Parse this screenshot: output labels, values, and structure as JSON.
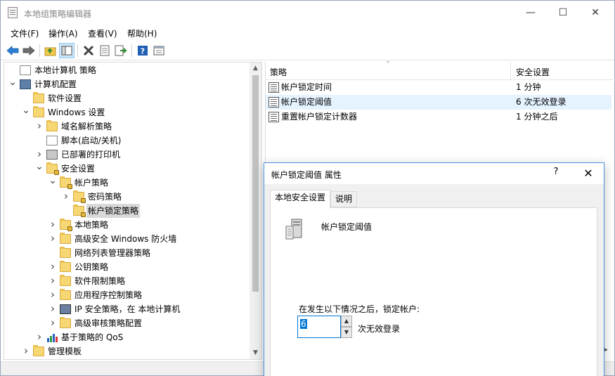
{
  "window": {
    "title": "本地组策略编辑器",
    "minimize": "—",
    "maximize": "☐",
    "close": "✕"
  },
  "menu": [
    "文件(F)",
    "操作(A)",
    "查看(V)",
    "帮助(H)"
  ],
  "toolbar": [
    "back-icon",
    "forward-icon",
    "up-icon",
    "show-tree-icon",
    "delete-icon",
    "properties-icon",
    "export-icon",
    "help-icon",
    "view-icon"
  ],
  "tree": [
    {
      "label": "本地计算机 策略",
      "icon": "policy-doc",
      "depth": 0,
      "chevron": ""
    },
    {
      "label": "计算机配置",
      "icon": "computer",
      "depth": 0,
      "chevron": "expanded"
    },
    {
      "label": "软件设置",
      "icon": "folder",
      "depth": 1,
      "chevron": ""
    },
    {
      "label": "Windows 设置",
      "icon": "folder",
      "depth": 1,
      "chevron": "expanded"
    },
    {
      "label": "域名解析策略",
      "icon": "folder",
      "depth": 2,
      "chevron": "collapsed"
    },
    {
      "label": "脚本(启动/关机)",
      "icon": "script",
      "depth": 2,
      "chevron": ""
    },
    {
      "label": "已部署的打印机",
      "icon": "printer",
      "depth": 2,
      "chevron": "collapsed"
    },
    {
      "label": "安全设置",
      "icon": "security",
      "depth": 2,
      "chevron": "expanded"
    },
    {
      "label": "帐户策略",
      "icon": "folder-lock",
      "depth": 3,
      "chevron": "expanded"
    },
    {
      "label": "密码策略",
      "icon": "folder-lock",
      "depth": 4,
      "chevron": "collapsed"
    },
    {
      "label": "帐户锁定策略",
      "icon": "folder-lock",
      "depth": 4,
      "chevron": "",
      "selected": true
    },
    {
      "label": "本地策略",
      "icon": "folder-lock",
      "depth": 3,
      "chevron": "collapsed"
    },
    {
      "label": "高级安全 Windows 防火墙",
      "icon": "folder",
      "depth": 3,
      "chevron": "collapsed"
    },
    {
      "label": "网络列表管理器策略",
      "icon": "folder",
      "depth": 3,
      "chevron": ""
    },
    {
      "label": "公钥策略",
      "icon": "folder",
      "depth": 3,
      "chevron": "collapsed"
    },
    {
      "label": "软件限制策略",
      "icon": "folder",
      "depth": 3,
      "chevron": "collapsed"
    },
    {
      "label": "应用程序控制策略",
      "icon": "folder",
      "depth": 3,
      "chevron": "collapsed"
    },
    {
      "label": "IP 安全策略，在 本地计算机",
      "icon": "netpc",
      "depth": 3,
      "chevron": "collapsed"
    },
    {
      "label": "高级审核策略配置",
      "icon": "folder",
      "depth": 3,
      "chevron": "collapsed"
    },
    {
      "label": "基于策略的 QoS",
      "icon": "chart",
      "depth": 2,
      "chevron": "collapsed"
    },
    {
      "label": "管理模板",
      "icon": "folder",
      "depth": 1,
      "chevron": "collapsed"
    }
  ],
  "list": {
    "col_policy": "策略",
    "col_setting": "安全设置",
    "rows": [
      {
        "name": "帐户锁定时间",
        "value": "1 分钟"
      },
      {
        "name": "帐户锁定阈值",
        "value": "6 次无效登录",
        "selected": true
      },
      {
        "name": "重置帐户锁定计数器",
        "value": "1 分钟之后"
      }
    ]
  },
  "dialog": {
    "title": "帐户锁定阈值 属性",
    "help": "?",
    "close": "✕",
    "tabs": [
      "本地安全设置",
      "说明"
    ],
    "policy_name": "帐户锁定阈值",
    "lock_label": "在发生以下情况之后，锁定帐户:",
    "value": "6",
    "unit": "次无效登录"
  }
}
